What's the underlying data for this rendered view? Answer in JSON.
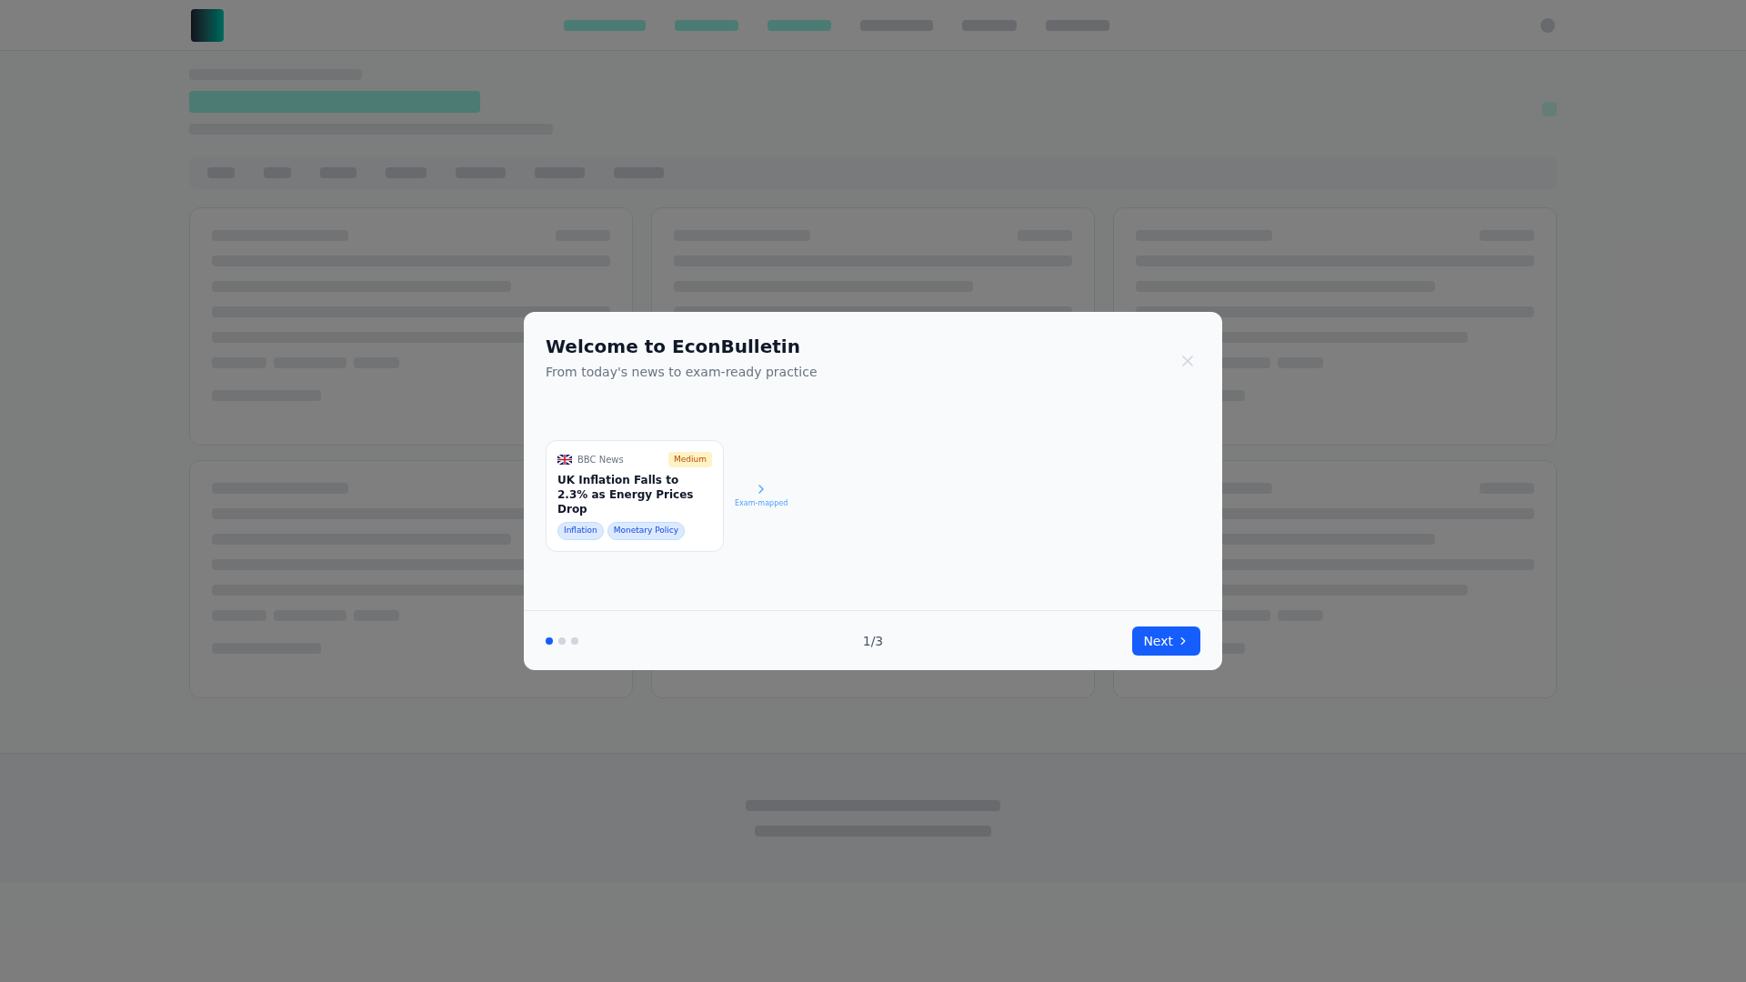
{
  "modal": {
    "title": "Welcome to EconBulletin",
    "subtitle": "From today's news to exam-ready practice",
    "card": {
      "source": "BBC News",
      "difficulty": "Medium",
      "headline": "UK Inflation Falls to 2.3% as Energy Prices Drop",
      "tags": [
        "Inflation",
        "Monetary Policy"
      ]
    },
    "arrow_label": "Exam-mapped",
    "steps": [
      {
        "selected": true
      },
      {
        "selected": false
      },
      {
        "selected": false
      }
    ],
    "counter": "1/3",
    "next": "Next"
  }
}
